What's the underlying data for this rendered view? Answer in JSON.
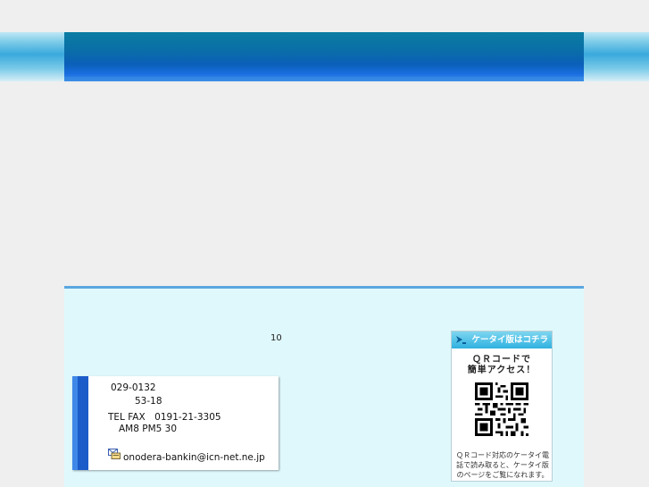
{
  "footer": {
    "count_text": "10",
    "address": {
      "postal": "029-0132",
      "street_number": "53-18",
      "phone": "TEL FAX　0191-21-3305",
      "hours": "AM8  PM5 30",
      "email": "onodera-bankin@icn-net.ne.jp"
    },
    "qr": {
      "header": "ケータイ版はコチラ",
      "title_line1": "ＱＲコードで",
      "title_line2": "簡単アクセス！",
      "note": "ＱＲコード対応のケータイ電話で読み取ると、ケータイ版のページをご覧になれます。"
    }
  },
  "colors": {
    "banner": "#0a6fa6",
    "footer_bg": "#dff8fc",
    "footer_border": "#5aa6e0",
    "card_bar": "#1b5cc9",
    "qr_header": "#2fb1e0"
  },
  "icons": [
    "mail-icon",
    "arrow-icon",
    "qr-code-icon"
  ]
}
